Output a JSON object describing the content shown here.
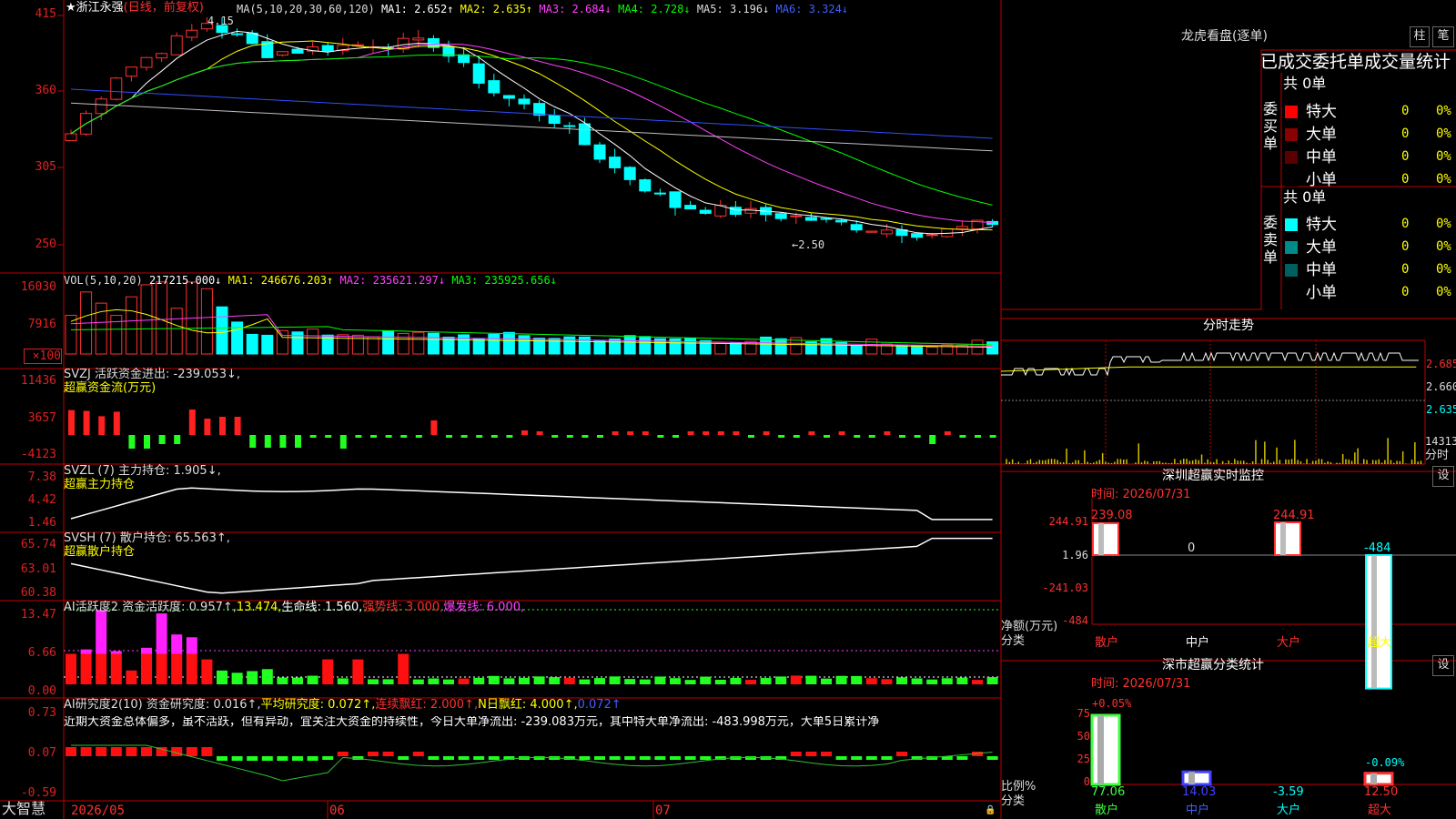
{
  "stock": {
    "title_icon": "★",
    "name": "浙江永强",
    "mode": "(日线，前复权)",
    "high_mark": "4.15",
    "low_mark": "←2.50"
  },
  "main_ma": {
    "label": "MA(5,10,20,30,60,120)",
    "ma1": "MA1: 2.652↑",
    "ma2": "MA2: 2.635↑",
    "ma3": "MA3: 2.684↓",
    "ma4": "MA4: 2.728↓",
    "ma5": "MA5: 3.196↓",
    "ma6": "MA6: 3.324↓"
  },
  "main_y": [
    "415",
    "360",
    "305",
    "250"
  ],
  "vol": {
    "label": "VOL(5,10,20)",
    "value": "217215.000↓",
    "ma1": "MA1: 246676.203↑",
    "ma2": "MA2: 235621.297↓",
    "ma3": "MA3: 235925.656↓",
    "y": [
      "16030",
      "7916",
      "×100"
    ]
  },
  "svzj": {
    "label": "SVZJ  活跃资金进出: -239.053↓,",
    "sub": "超赢资金流(万元)",
    "y": [
      "11436",
      "3657",
      "-4123"
    ]
  },
  "svzl": {
    "label": "SVZL (7) 主力持仓: 1.905↓,",
    "sub": "超赢主力持仓",
    "y": [
      "7.38",
      "4.42",
      "1.46"
    ]
  },
  "svsh": {
    "label": "SVSH (7) 散户持仓: 65.563↑,",
    "sub": "超赢散户持仓",
    "y": [
      "65.74",
      "63.01",
      "60.38"
    ]
  },
  "ai1": {
    "label": "AI活跃度2 资金活跃度: 0.957↑,",
    "v2": "13.474,",
    "v3": "生命线: 1.560,",
    "v4": "强势线: 3.000,",
    "v5": "爆发线: 6.000,",
    "y": [
      "13.47",
      "6.66",
      "0.00"
    ]
  },
  "ai2": {
    "label": "AI研究度2(10) 资金研究度: 0.016↑,",
    "v2": "平均研究度: 0.072↑,",
    "v3": "连续飘红: 2.000↑,",
    "v4": "N日飘红: 4.000↑,",
    "v5": "0.072↑",
    "note": "近期大资金总体偏多，虽不活跃，但有异动，宜关注大资金的持续性，今日大单净流出: -239.083万元，其中特大单净流出: -483.998万元，大单5日累计净",
    "y": [
      "0.73",
      "0.07",
      "-0.59"
    ]
  },
  "xaxis": [
    "2026/05",
    "06",
    "07"
  ],
  "brand": "大智慧",
  "right": {
    "lhb_title": "龙虎看盘(逐单)",
    "tab_zhu": "柱",
    "tab_bi": "笔",
    "stats_header": "已成交委托单成交量统计",
    "buy_total": "共 0单",
    "sell_total": "共 0单",
    "buy_side": "委买单",
    "sell_side": "委卖单",
    "rows": [
      {
        "label": "特大",
        "count": "0",
        "pct": "0%",
        "color": "#ff0000",
        "color2": "#00ffff"
      },
      {
        "label": "大单",
        "count": "0",
        "pct": "0%",
        "color": "#8b0000",
        "color2": "#008b8b"
      },
      {
        "label": "中单",
        "count": "0",
        "pct": "0%",
        "color": "#5a0000",
        "color2": "#006060"
      },
      {
        "label": "小单",
        "count": "0",
        "pct": "0%",
        "color": "#000000",
        "color2": "#000000"
      }
    ],
    "fs_title": "分时走势",
    "fs_y": [
      "2.685",
      "2.660",
      "2.635"
    ],
    "fs_vol": "14313",
    "fs_unit": "分时",
    "sz_title": "深圳超赢实时监控",
    "sz_set": "设",
    "sz_time": "时间: 2026/07/31",
    "sz_y": [
      "244.91",
      "1.96",
      "-241.03",
      "-484"
    ],
    "sz_unit": "净额(万元)",
    "sz_cat": "分类",
    "sz_bars": [
      {
        "label": "散户",
        "value": 239.08,
        "text": "239.08",
        "color": "#ff3030"
      },
      {
        "label": "中户",
        "value": 0,
        "text": "0",
        "color": "#ffffff"
      },
      {
        "label": "大户",
        "value": 244.91,
        "text": "244.91",
        "color": "#ff3030"
      },
      {
        "label": "超大",
        "value": -484,
        "text": "-484",
        "color": "#00ffff"
      }
    ],
    "fl_title": "深市超赢分类统计",
    "fl_set": "设",
    "fl_time": "时间: 2026/07/31",
    "fl_top": "+0.05%",
    "fl_y": [
      "75",
      "50",
      "25",
      "0"
    ],
    "fl_unit": "比例%",
    "fl_cat": "分类",
    "fl_bars": [
      {
        "label": "散户",
        "value": 77.06,
        "text": "77.06",
        "color": "#40ff40"
      },
      {
        "label": "中户",
        "value": 14.03,
        "text": "14.03",
        "color": "#4040ff"
      },
      {
        "label": "大户",
        "value": -3.59,
        "text": "-3.59",
        "color": "#00ffff"
      },
      {
        "label": "超大",
        "value": 12.5,
        "text": "12.50",
        "color": "#ff3030"
      }
    ],
    "fl_right": "-0.09%"
  }
}
